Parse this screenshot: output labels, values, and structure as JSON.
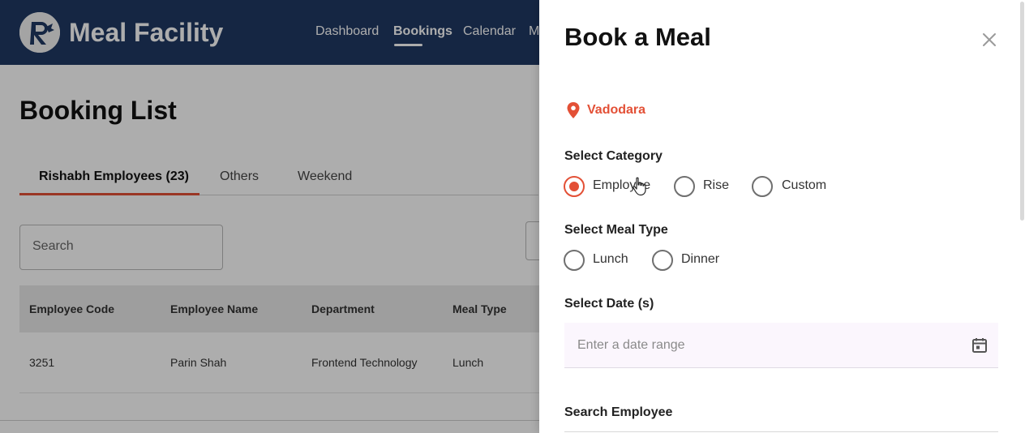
{
  "app": {
    "title": "Meal Facility",
    "nav": [
      "Dashboard",
      "Bookings",
      "Calendar",
      "M"
    ],
    "active_nav": "Bookings"
  },
  "page": {
    "title": "Booking List",
    "tabs": [
      "Rishabh Employees (23)",
      "Others",
      "Weekend"
    ],
    "active_tab": "Rishabh Employees (23)",
    "search_placeholder": "Search",
    "table": {
      "columns": [
        "Employee Code",
        "Employee Name",
        "Department",
        "Meal Type"
      ],
      "rows": [
        [
          "3251",
          "Parin Shah",
          "Frontend Technology",
          "Lunch"
        ]
      ]
    }
  },
  "drawer": {
    "title": "Book a Meal",
    "location": "Vadodara",
    "category": {
      "label": "Select Category",
      "options": [
        "Employee",
        "Rise",
        "Custom"
      ],
      "selected": "Employee"
    },
    "meal_type": {
      "label": "Select Meal Type",
      "options": [
        "Lunch",
        "Dinner"
      ],
      "selected": null
    },
    "date": {
      "label": "Select Date (s)",
      "placeholder": "Enter a date range"
    },
    "employee": {
      "label": "Search Employee"
    }
  },
  "colors": {
    "header_bg": "#1f3864",
    "accent": "#e35036",
    "date_field_bg": "#fbf6fd"
  }
}
